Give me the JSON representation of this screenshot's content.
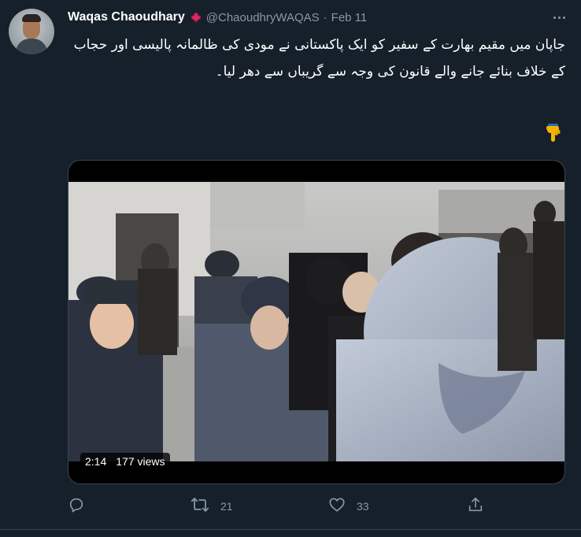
{
  "author": {
    "name": "Waqas Chaoudhary",
    "flag_icon": "canada-maple-leaf-icon",
    "handle": "@ChaoudhryWAQAS",
    "separator": "·",
    "date": "Feb 11"
  },
  "tweet": {
    "text": "جاپان میں مقیم بھارت کے سفیر کو ایک پاکستانی نے مودی کی ظالمانہ پالیسی اور حجاب کے خلاف بنائے جانے والے قانون کی وجہ سے گریباں سے دھر لیا۔",
    "emoji_icon": "pointing-down-hand-icon"
  },
  "media": {
    "duration": "2:14",
    "views": "177 views"
  },
  "actions": {
    "reply_icon": "reply-icon",
    "retweet_icon": "retweet-icon",
    "retweet_count": "21",
    "like_icon": "heart-icon",
    "like_count": "33",
    "share_icon": "share-icon"
  },
  "colors": {
    "background": "#15202b",
    "secondary_text": "#8899a6",
    "flag_red": "#e0245e"
  }
}
